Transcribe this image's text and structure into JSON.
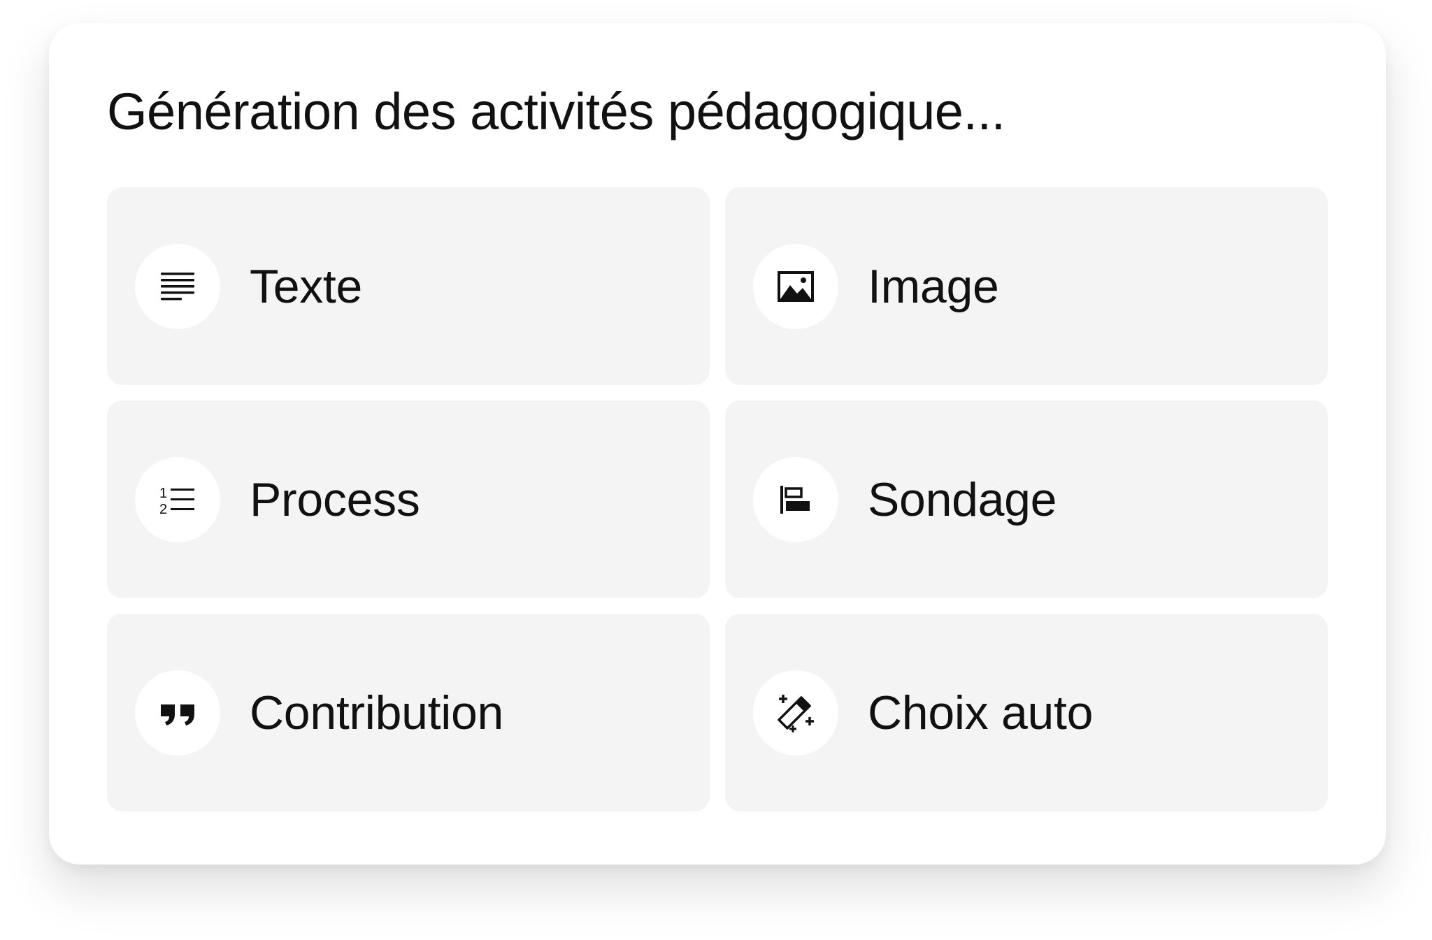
{
  "title": "Génération des activités pédagogique...",
  "activities": [
    {
      "label": "Texte",
      "icon": "text-lines-icon"
    },
    {
      "label": "Image",
      "icon": "image-icon"
    },
    {
      "label": "Process",
      "icon": "numbered-list-icon"
    },
    {
      "label": "Sondage",
      "icon": "poll-bars-icon"
    },
    {
      "label": "Contribution",
      "icon": "quote-icon"
    },
    {
      "label": "Choix auto",
      "icon": "magic-wand-icon"
    }
  ],
  "colors": {
    "card_background": "#f4f4f4",
    "text": "#111111",
    "icon_background": "#ffffff"
  }
}
